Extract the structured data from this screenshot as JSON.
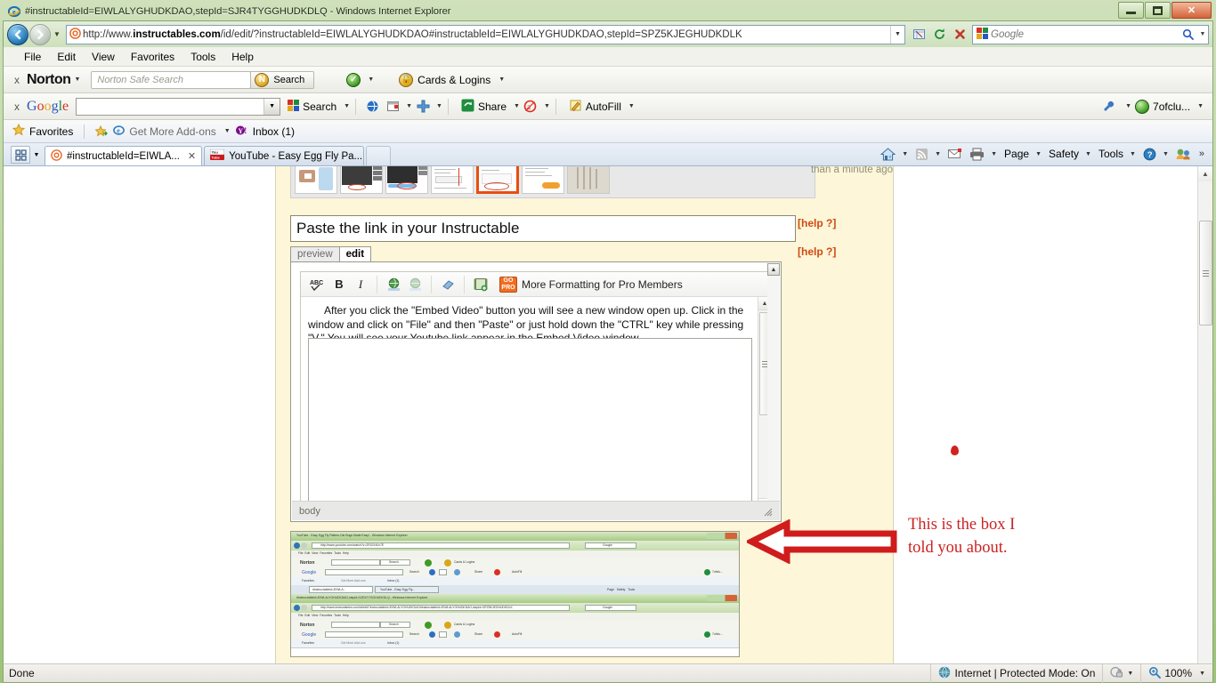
{
  "window": {
    "title": "#instructableId=EIWLALYGHUDKDAO,stepId=SJR4TYGGHUDKDLQ - Windows Internet Explorer",
    "app_icon": "internet-explorer-icon",
    "minimize_label": "Minimize",
    "maximize_label": "Restore",
    "close_label": "Close"
  },
  "nav": {
    "back_label": "Back",
    "forward_label": "Forward",
    "history_label": "Recent Pages",
    "url": "http://www.instructables.com/id/edit/?instructableId=EIWLALYGHUDKDAO#instructableId=EIWLALYGHUDKDAO,stepId=SPZ5KJEGHUDKDLK",
    "url_prefix": "http://www.",
    "url_domain": "instructables.com",
    "url_suffix": "/id/edit/?instructableId=EIWLALYGHUDKDAO#instructableId=EIWLALYGHUDKDAO,stepId=SPZ5KJEGHUDKDLK",
    "compat_label": "Compatibility View",
    "refresh_label": "Refresh",
    "stop_label": "Stop",
    "search_engine": "Google",
    "search_placeholder": "Google",
    "search_value": ""
  },
  "menu": {
    "items": [
      "File",
      "Edit",
      "View",
      "Favorites",
      "Tools",
      "Help"
    ]
  },
  "norton_toolbar": {
    "close_label": "x",
    "brand": "Norton",
    "search_placeholder": "Norton Safe Search",
    "search_value": "",
    "search_button": "Search",
    "safe_web_label": "Norton Safe Web",
    "cards_logins": "Cards & Logins"
  },
  "google_toolbar": {
    "close_label": "x",
    "brand_letters": [
      {
        "ch": "G",
        "cls": "b"
      },
      {
        "ch": "o",
        "cls": "r"
      },
      {
        "ch": "o",
        "cls": "y"
      },
      {
        "ch": "g",
        "cls": "b"
      },
      {
        "ch": "l",
        "cls": "g"
      },
      {
        "ch": "e",
        "cls": "r"
      }
    ],
    "search_value": "",
    "search_button": "Search",
    "translate_label": "Translate",
    "popup_blocker_label": "Pop-up blocker",
    "more_label": "More",
    "share_button": "Share",
    "highlight_label": "Highlight",
    "autofill_button": "AutoFill",
    "settings_label": "Settings",
    "account_name": "7ofclu..."
  },
  "favorites_bar": {
    "favorites_label": "Favorites",
    "items": [
      {
        "label": "Get More Add-ons",
        "icon": "internet-explorer-icon",
        "has_caret": true
      },
      {
        "label": "Inbox (1)",
        "icon": "yahoo-icon",
        "has_caret": false
      }
    ]
  },
  "tabs": {
    "quick_tabs_label": "Quick Tabs",
    "items": [
      {
        "label": "#instructableId=EIWLA...",
        "icon": "instructables-icon",
        "active": true,
        "closable": true
      },
      {
        "label": "YouTube - Easy Egg Fly Pa...",
        "icon": "youtube-icon",
        "active": false,
        "closable": false
      }
    ],
    "new_tab_label": "New Tab"
  },
  "command_bar": {
    "items": [
      {
        "label": "",
        "icon": "home-icon",
        "caret": true
      },
      {
        "label": "",
        "icon": "feeds-icon",
        "caret": true
      },
      {
        "label": "",
        "icon": "mail-icon",
        "caret": false
      },
      {
        "label": "",
        "icon": "print-icon",
        "caret": true
      },
      {
        "label": "Page",
        "icon": "",
        "caret": true
      },
      {
        "label": "Safety",
        "icon": "",
        "caret": true
      },
      {
        "label": "Tools",
        "icon": "",
        "caret": true
      },
      {
        "label": "",
        "icon": "help-icon",
        "caret": true
      },
      {
        "label": "",
        "icon": "messenger-icon",
        "caret": false
      }
    ],
    "overflow_label": "»"
  },
  "page": {
    "timestamp": "than a minute ago",
    "step_title": "Paste the link in your Instructable",
    "help_title": "[help ?]",
    "help_body": "[help ?]",
    "mode_tabs": [
      {
        "label": "preview",
        "active": false
      },
      {
        "label": "edit",
        "active": true
      }
    ],
    "editor": {
      "toolbar": {
        "spellcheck_label": "ABC",
        "bold_label": "B",
        "italic_label": "I",
        "link_label": "Insert/edit link",
        "unlink_label": "Unlink",
        "eraser_label": "Remove formatting",
        "embed_video_label": "Embed Video",
        "pro_badge_top": "GO",
        "pro_badge_bottom": "PRO",
        "pro_text": "More Formatting for Pro Members"
      },
      "body_text": "After you click the \"Embed Video\" button you will see a new window open up.  Click in the window and click on \"File\" and then \"Paste\" or just hold down the \"CTRL\" key while pressing \"V.\"  You will see your Youtube link appear in the Embed Video window.",
      "path_label": "body",
      "resize_label": "Resize editor"
    },
    "thumbnails": [
      {
        "selected": false,
        "kind": "hand-phone"
      },
      {
        "selected": false,
        "kind": "browser-dark"
      },
      {
        "selected": false,
        "kind": "browser-dark-blue"
      },
      {
        "selected": false,
        "kind": "browser-light"
      },
      {
        "selected": true,
        "kind": "browser-circled"
      },
      {
        "selected": false,
        "kind": "browser-orange"
      },
      {
        "selected": false,
        "kind": "hands-sketch"
      }
    ],
    "screenshot_caption": "Nested Internet Explorer screenshot"
  },
  "annotation": {
    "arrow_label": "red-left-arrow",
    "text_line1": "This is the box I",
    "text_line2": "told you about.",
    "dot_label": "red-dot",
    "color": "#cc2222"
  },
  "status_bar": {
    "message": "Done",
    "zone_icon": "globe-icon",
    "zone": "Internet | Protected Mode: On",
    "privacy_icon": "privacy-icon",
    "zoom_icon": "zoom-icon",
    "zoom": "100%"
  }
}
